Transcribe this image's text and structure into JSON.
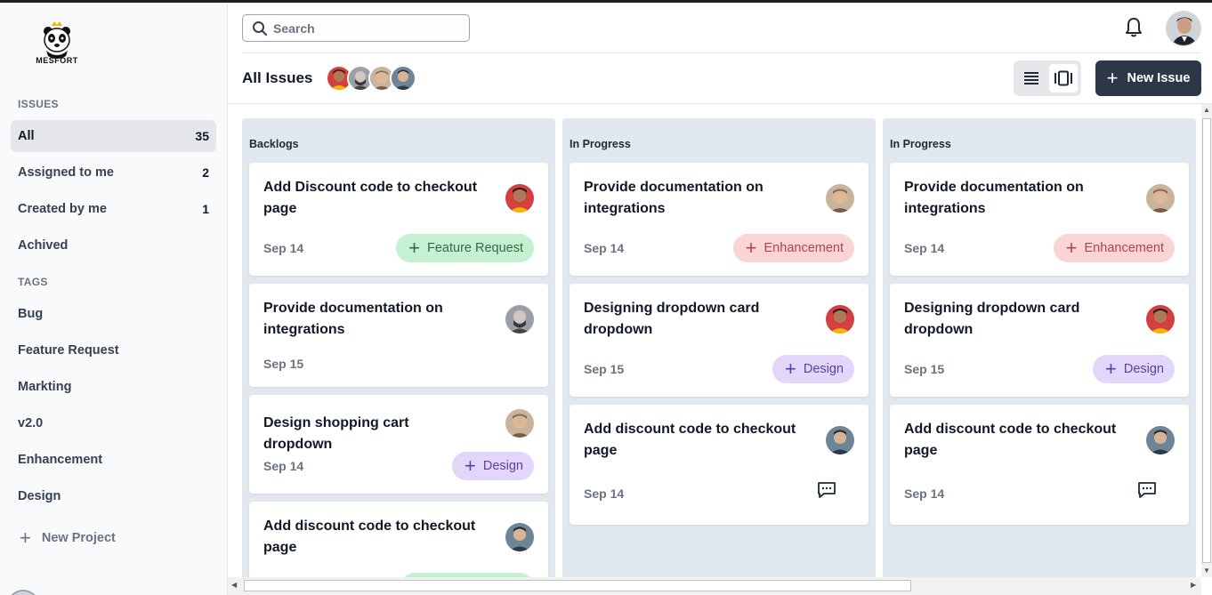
{
  "app": {
    "logo_text": "MESFORT"
  },
  "sidebar": {
    "issues_label": "ISSUES",
    "issues": [
      {
        "label": "All",
        "count": "35"
      },
      {
        "label": "Assigned to me",
        "count": "2"
      },
      {
        "label": "Created by me",
        "count": "1"
      },
      {
        "label": "Achived",
        "count": ""
      }
    ],
    "tags_label": "TAGS",
    "tags": [
      {
        "label": "Bug"
      },
      {
        "label": "Feature Request"
      },
      {
        "label": "Markting"
      },
      {
        "label": "v2.0"
      },
      {
        "label": "Enhancement"
      },
      {
        "label": "Design"
      }
    ],
    "new_project_label": "New Project"
  },
  "header": {
    "search_placeholder": "Search",
    "page_title": "All Issues",
    "new_issue_label": "New Issue"
  },
  "columns": [
    {
      "title": "Backlogs",
      "cards": [
        {
          "title": "Add Discount code to checkout page",
          "date": "Sep 14",
          "tag": "Feature Request"
        },
        {
          "title": "Provide documentation on integrations",
          "date": "Sep 15",
          "tag": ""
        },
        {
          "title": "Design shopping cart dropdown",
          "date": "Sep 14",
          "tag": "Design"
        },
        {
          "title": "Add discount code to checkout page",
          "date": "",
          "tag": ""
        }
      ]
    },
    {
      "title": "In Progress",
      "cards": [
        {
          "title": "Provide documentation on integrations",
          "date": "Sep 14",
          "tag": "Enhancement"
        },
        {
          "title": "Designing dropdown card dropdown",
          "date": "Sep 15",
          "tag": "Design"
        },
        {
          "title": "Add discount code to checkout page",
          "date": "Sep 14",
          "tag": ""
        }
      ]
    },
    {
      "title": "In Progress",
      "cards": [
        {
          "title": "Provide documentation on integrations",
          "date": "Sep 14",
          "tag": "Enhancement"
        },
        {
          "title": "Designing dropdown card dropdown",
          "date": "Sep 15",
          "tag": "Design"
        },
        {
          "title": "Add discount code to checkout page",
          "date": "Sep 14",
          "tag": ""
        }
      ]
    }
  ],
  "colors": {
    "primary_button": "#2d3748",
    "column_bg": "#e2e8f0",
    "feature_tag": "#c6f0d2",
    "enhancement_tag": "#fbd5d5",
    "design_tag": "#e3d6fb"
  }
}
